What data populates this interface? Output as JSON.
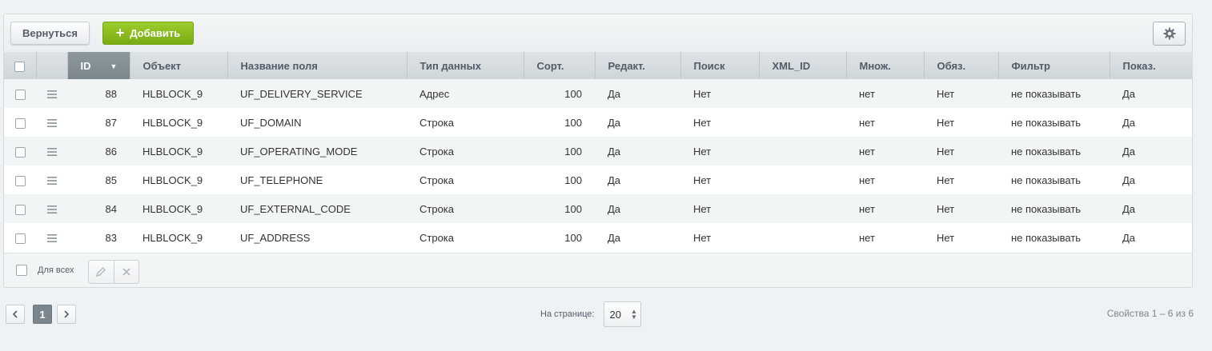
{
  "toolbar": {
    "back_label": "Вернуться",
    "add_label": "Добавить",
    "add_icon": "plus-icon",
    "settings_icon": "gear-icon"
  },
  "table": {
    "columns": [
      "ID",
      "Объект",
      "Название поля",
      "Тип данных",
      "Сорт.",
      "Редакт.",
      "Поиск",
      "XML_ID",
      "Множ.",
      "Обяз.",
      "Фильтр",
      "Показ."
    ],
    "sorted_column": "ID",
    "rows": [
      {
        "id": "88",
        "object": "HLBLOCK_9",
        "field": "UF_DELIVERY_SERVICE",
        "type": "Адрес",
        "sort": "100",
        "edit": "Да",
        "search": "Нет",
        "xml_id": "",
        "multiple": "нет",
        "required": "Нет",
        "filter": "не показывать",
        "show": "Да"
      },
      {
        "id": "87",
        "object": "HLBLOCK_9",
        "field": "UF_DOMAIN",
        "type": "Строка",
        "sort": "100",
        "edit": "Да",
        "search": "Нет",
        "xml_id": "",
        "multiple": "нет",
        "required": "Нет",
        "filter": "не показывать",
        "show": "Да"
      },
      {
        "id": "86",
        "object": "HLBLOCK_9",
        "field": "UF_OPERATING_MODE",
        "type": "Строка",
        "sort": "100",
        "edit": "Да",
        "search": "Нет",
        "xml_id": "",
        "multiple": "нет",
        "required": "Нет",
        "filter": "не показывать",
        "show": "Да"
      },
      {
        "id": "85",
        "object": "HLBLOCK_9",
        "field": "UF_TELEPHONE",
        "type": "Строка",
        "sort": "100",
        "edit": "Да",
        "search": "Нет",
        "xml_id": "",
        "multiple": "нет",
        "required": "Нет",
        "filter": "не показывать",
        "show": "Да"
      },
      {
        "id": "84",
        "object": "HLBLOCK_9",
        "field": "UF_EXTERNAL_CODE",
        "type": "Строка",
        "sort": "100",
        "edit": "Да",
        "search": "Нет",
        "xml_id": "",
        "multiple": "нет",
        "required": "Нет",
        "filter": "не показывать",
        "show": "Да"
      },
      {
        "id": "83",
        "object": "HLBLOCK_9",
        "field": "UF_ADDRESS",
        "type": "Строка",
        "sort": "100",
        "edit": "Да",
        "search": "Нет",
        "xml_id": "",
        "multiple": "нет",
        "required": "Нет",
        "filter": "не показывать",
        "show": "Да"
      }
    ]
  },
  "footer": {
    "for_all_label": "Для всех",
    "edit_icon": "pencil-icon",
    "delete_icon": "close-icon"
  },
  "pagination": {
    "current_page": "1",
    "per_page_label": "На странице:",
    "per_page_value": "20",
    "summary": "Свойства 1 – 6 из 6"
  },
  "colors": {
    "accent_green": "#8bbf1f",
    "header_bg": "#d5dbde",
    "sorted_header_bg": "#848e95"
  }
}
